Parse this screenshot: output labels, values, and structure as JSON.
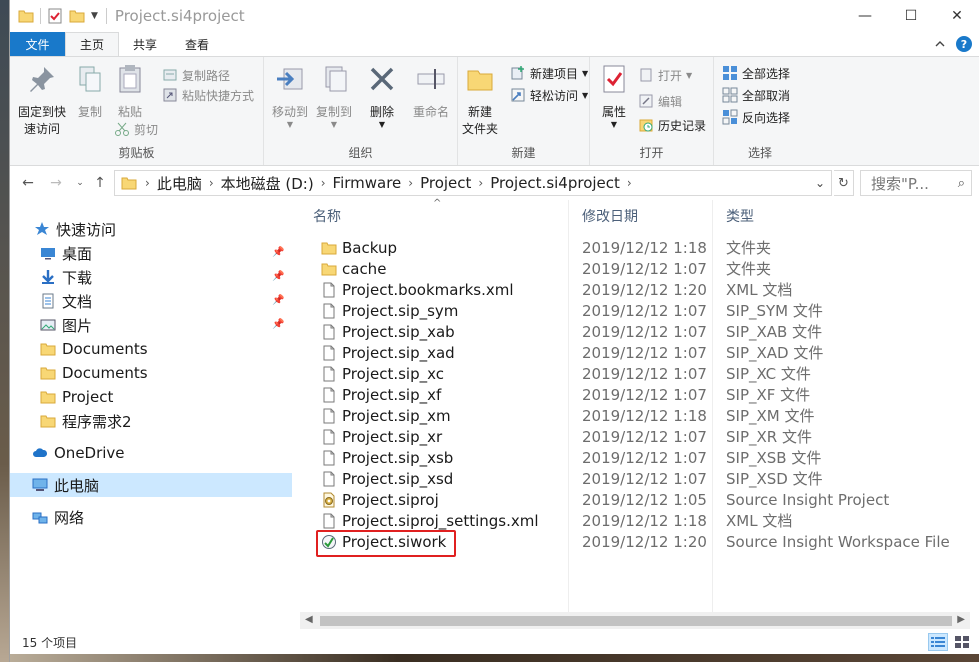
{
  "window": {
    "title": "Project.si4project"
  },
  "tabs": [
    {
      "label": "文件"
    },
    {
      "label": "主页"
    },
    {
      "label": "共享"
    },
    {
      "label": "查看"
    }
  ],
  "ribbon": {
    "clipboard": {
      "label": "剪贴板",
      "pin": "固定到快速访问",
      "pin_line1": "固定到快",
      "pin_line2": "速访问",
      "copy": "复制",
      "paste": "粘贴",
      "copy_path": "复制路径",
      "paste_shortcut": "粘贴快捷方式",
      "cut": "剪切"
    },
    "organize": {
      "label": "组织",
      "move_to": "移动到",
      "copy_to": "复制到",
      "delete": "删除",
      "rename": "重命名"
    },
    "new": {
      "label": "新建",
      "new_folder_line1": "新建",
      "new_folder_line2": "文件夹",
      "new_item": "新建项目",
      "easy_access": "轻松访问"
    },
    "open": {
      "label": "打开",
      "properties": "属性",
      "open": "打开",
      "edit": "编辑",
      "history": "历史记录"
    },
    "select": {
      "label": "选择",
      "select_all": "全部选择",
      "select_none": "全部取消",
      "invert": "反向选择"
    }
  },
  "address": {
    "crumbs": [
      "此电脑",
      "本地磁盘 (D:)",
      "Firmware",
      "Project",
      "Project.si4project"
    ],
    "search_placeholder": "搜索\"P..."
  },
  "nav": {
    "quick_access": "快速访问",
    "items": [
      {
        "label": "桌面",
        "pinned": true
      },
      {
        "label": "下载",
        "pinned": true
      },
      {
        "label": "文档",
        "pinned": true
      },
      {
        "label": "图片",
        "pinned": true
      },
      {
        "label": "Documents",
        "pinned": false
      },
      {
        "label": "Documents",
        "pinned": false
      },
      {
        "label": "Project",
        "pinned": false
      },
      {
        "label": "程序需求2",
        "pinned": false
      }
    ],
    "onedrive": "OneDrive",
    "this_pc": "此电脑",
    "network": "网络"
  },
  "columns": {
    "name": "名称",
    "date": "修改日期",
    "type": "类型"
  },
  "files": [
    {
      "name": "Backup",
      "date": "2019/12/12 1:18",
      "type": "文件夹",
      "icon": "folder-icon"
    },
    {
      "name": "cache",
      "date": "2019/12/12 1:07",
      "type": "文件夹",
      "icon": "folder-icon"
    },
    {
      "name": "Project.bookmarks.xml",
      "date": "2019/12/12 1:20",
      "type": "XML 文档",
      "icon": "file-icon"
    },
    {
      "name": "Project.sip_sym",
      "date": "2019/12/12 1:07",
      "type": "SIP_SYM 文件",
      "icon": "file-icon"
    },
    {
      "name": "Project.sip_xab",
      "date": "2019/12/12 1:07",
      "type": "SIP_XAB 文件",
      "icon": "file-icon"
    },
    {
      "name": "Project.sip_xad",
      "date": "2019/12/12 1:07",
      "type": "SIP_XAD 文件",
      "icon": "file-icon"
    },
    {
      "name": "Project.sip_xc",
      "date": "2019/12/12 1:07",
      "type": "SIP_XC 文件",
      "icon": "file-icon"
    },
    {
      "name": "Project.sip_xf",
      "date": "2019/12/12 1:07",
      "type": "SIP_XF 文件",
      "icon": "file-icon"
    },
    {
      "name": "Project.sip_xm",
      "date": "2019/12/12 1:18",
      "type": "SIP_XM 文件",
      "icon": "file-icon"
    },
    {
      "name": "Project.sip_xr",
      "date": "2019/12/12 1:07",
      "type": "SIP_XR 文件",
      "icon": "file-icon"
    },
    {
      "name": "Project.sip_xsb",
      "date": "2019/12/12 1:07",
      "type": "SIP_XSB 文件",
      "icon": "file-icon"
    },
    {
      "name": "Project.sip_xsd",
      "date": "2019/12/12 1:07",
      "type": "SIP_XSD 文件",
      "icon": "file-icon"
    },
    {
      "name": "Project.siproj",
      "date": "2019/12/12 1:05",
      "type": "Source Insight Project",
      "icon": "siproj-icon"
    },
    {
      "name": "Project.siproj_settings.xml",
      "date": "2019/12/12 1:18",
      "type": "XML 文档",
      "icon": "file-icon"
    },
    {
      "name": "Project.siwork",
      "date": "2019/12/12 1:20",
      "type": "Source Insight Workspace File",
      "icon": "siwork-icon"
    }
  ],
  "status": {
    "count": "15 个项目"
  },
  "colors": {
    "accent": "#1979ca",
    "selection": "#cce8ff",
    "highlight": "#e02020",
    "folder": "#f8d775"
  }
}
